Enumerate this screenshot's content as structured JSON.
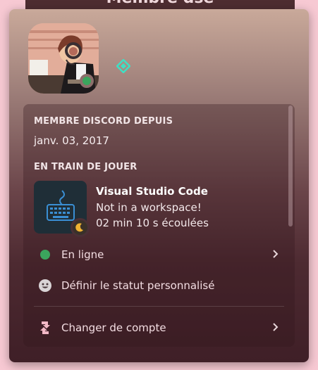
{
  "background_panel": {
    "title": "Membre dse"
  },
  "profile": {
    "status_color": "#3ba55d",
    "badge_color": "#3ee0c4",
    "avatar_icon": "user-avatar"
  },
  "member_since": {
    "label": "MEMBRE DISCORD DEPUIS",
    "date": "janv. 03, 2017"
  },
  "activity": {
    "label": "EN TRAIN DE JOUER",
    "game_name": "Visual Studio Code",
    "detail": "Not in a workspace!",
    "elapsed": "02 min 10 s écoulées",
    "icon": "keyboard-icon",
    "accent": "#3a8fd4"
  },
  "menu": {
    "online_label": "En ligne",
    "custom_status_label": "Définir le statut personnalisé",
    "switch_account_label": "Changer de compte"
  },
  "colors": {
    "page_bg": "#f7c9d3",
    "text": "#f3dde2",
    "online": "#3ba55d"
  }
}
